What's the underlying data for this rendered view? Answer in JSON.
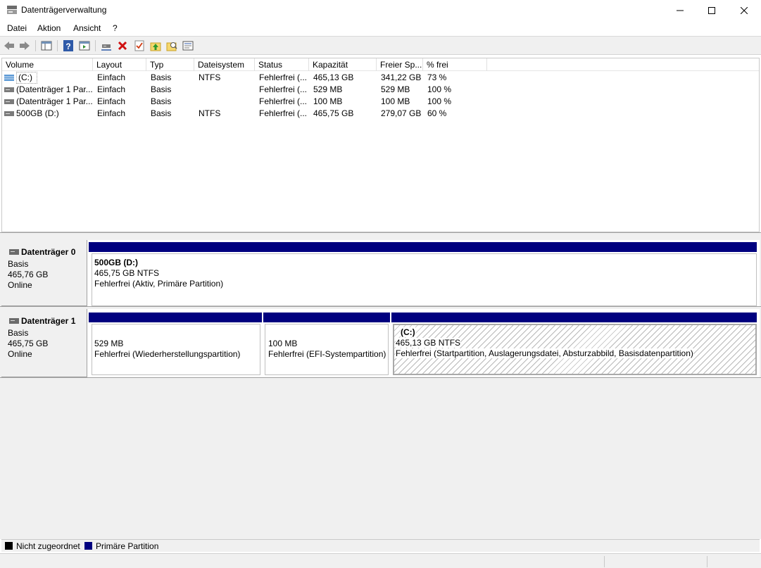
{
  "window": {
    "title": "Datenträgerverwaltung",
    "controls": [
      "minimize-icon",
      "maximize-icon",
      "close-icon"
    ]
  },
  "menu": [
    "Datei",
    "Aktion",
    "Ansicht",
    "?"
  ],
  "toolbar": {
    "icons": [
      "back-arrow-icon",
      "forward-arrow-icon",
      "console-tree-icon",
      "help-icon",
      "action-pane-icon",
      "connect-drive-icon",
      "delete-icon",
      "check-icon",
      "folder-up-icon",
      "search-folder-icon",
      "properties-icon"
    ]
  },
  "volume_table": {
    "columns": [
      "Volume",
      "Layout",
      "Typ",
      "Dateisystem",
      "Status",
      "Kapazität",
      "Freier Sp...",
      "% frei"
    ],
    "rows": [
      {
        "icon": "volume-striped-icon",
        "volume": "(C:)",
        "layout": "Einfach",
        "typ": "Basis",
        "dateisystem": "NTFS",
        "status": "Fehlerfrei (...",
        "kapazitaet": "465,13 GB",
        "frei": "341,22 GB",
        "prozent": "73 %"
      },
      {
        "icon": "volume-icon",
        "volume": "(Datenträger 1 Par...",
        "layout": "Einfach",
        "typ": "Basis",
        "dateisystem": "",
        "status": "Fehlerfrei (...",
        "kapazitaet": "529 MB",
        "frei": "529 MB",
        "prozent": "100 %"
      },
      {
        "icon": "volume-icon",
        "volume": "(Datenträger 1 Par...",
        "layout": "Einfach",
        "typ": "Basis",
        "dateisystem": "",
        "status": "Fehlerfrei (...",
        "kapazitaet": "100 MB",
        "frei": "100 MB",
        "prozent": "100 %"
      },
      {
        "icon": "volume-icon",
        "volume": "500GB (D:)",
        "layout": "Einfach",
        "typ": "Basis",
        "dateisystem": "NTFS",
        "status": "Fehlerfrei (...",
        "kapazitaet": "465,75 GB",
        "frei": "279,07 GB",
        "prozent": "60 %"
      }
    ]
  },
  "disks": [
    {
      "name": "Datenträger 0",
      "type": "Basis",
      "size": "465,76 GB",
      "state": "Online",
      "partitions": [
        {
          "title": "500GB  (D:)",
          "line1": "465,75 GB NTFS",
          "line2": "Fehlerfrei (Aktiv, Primäre Partition)"
        }
      ]
    },
    {
      "name": "Datenträger 1",
      "type": "Basis",
      "size": "465,75 GB",
      "state": "Online",
      "partitions": [
        {
          "title": "",
          "line1": "529 MB",
          "line2": "Fehlerfrei (Wiederherstellungspartition)"
        },
        {
          "title": "",
          "line1": "100 MB",
          "line2": "Fehlerfrei (EFI-Systempartition)"
        },
        {
          "title": "(C:)",
          "line1": "465,13 GB NTFS",
          "line2": "Fehlerfrei (Startpartition, Auslagerungsdatei, Absturzabbild, Basisdatenpartition)"
        }
      ]
    }
  ],
  "legend": [
    {
      "label": "Nicht zugeordnet",
      "color": "#000000"
    },
    {
      "label": "Primäre Partition",
      "color": "#00007f"
    }
  ],
  "colors": {
    "partition_bar": "#00007f",
    "background": "#f0f0f0"
  }
}
